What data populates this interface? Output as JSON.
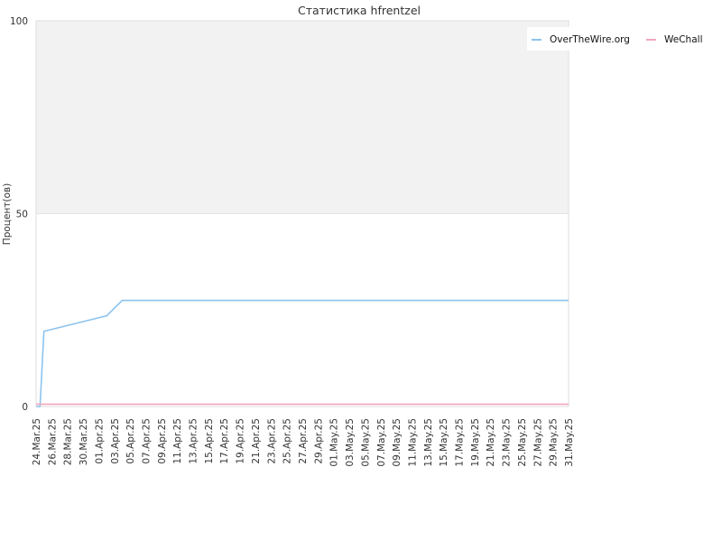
{
  "chart_data": {
    "type": "line",
    "title": "Статистика hfrentzel",
    "xlabel": "",
    "ylabel": "Процент(ов)",
    "ylim": [
      0,
      100
    ],
    "yticks": [
      0,
      50,
      100
    ],
    "x_range": [
      "2025-03-24",
      "2025-05-31"
    ],
    "xtick_labels": [
      "24.Mar.25",
      "26.Mar.25",
      "28.Mar.25",
      "30.Mar.25",
      "01.Apr.25",
      "03.Apr.25",
      "05.Apr.25",
      "07.Apr.25",
      "09.Apr.25",
      "11.Apr.25",
      "13.Apr.25",
      "15.Apr.25",
      "17.Apr.25",
      "19.Apr.25",
      "21.Apr.25",
      "23.Apr.25",
      "25.Apr.25",
      "27.Apr.25",
      "29.Apr.25",
      "01.May.25",
      "03.May.25",
      "05.May.25",
      "07.May.25",
      "09.May.25",
      "11.May.25",
      "13.May.25",
      "15.May.25",
      "17.May.25",
      "19.May.25",
      "21.May.25",
      "23.May.25",
      "25.May.25",
      "27.May.25",
      "29.May.25",
      "31.May.25"
    ],
    "legend_position": "top-right",
    "grid": true,
    "shaded_band": [
      50,
      100
    ],
    "series": [
      {
        "name": "OverTheWire.org",
        "color": "#8cc3ee",
        "points": [
          [
            "2025-03-24",
            0
          ],
          [
            "2025-03-24T12:00",
            0
          ],
          [
            "2025-03-24T20:00",
            13
          ],
          [
            "2025-03-25",
            19.5
          ],
          [
            "2025-04-02",
            23.5
          ],
          [
            "2025-04-04",
            27.5
          ],
          [
            "2025-05-31",
            27.5
          ]
        ]
      },
      {
        "name": "WeChall",
        "color": "#f2a7bd",
        "points": [
          [
            "2025-03-24",
            0.6
          ],
          [
            "2025-05-31",
            0.6
          ]
        ]
      }
    ]
  }
}
